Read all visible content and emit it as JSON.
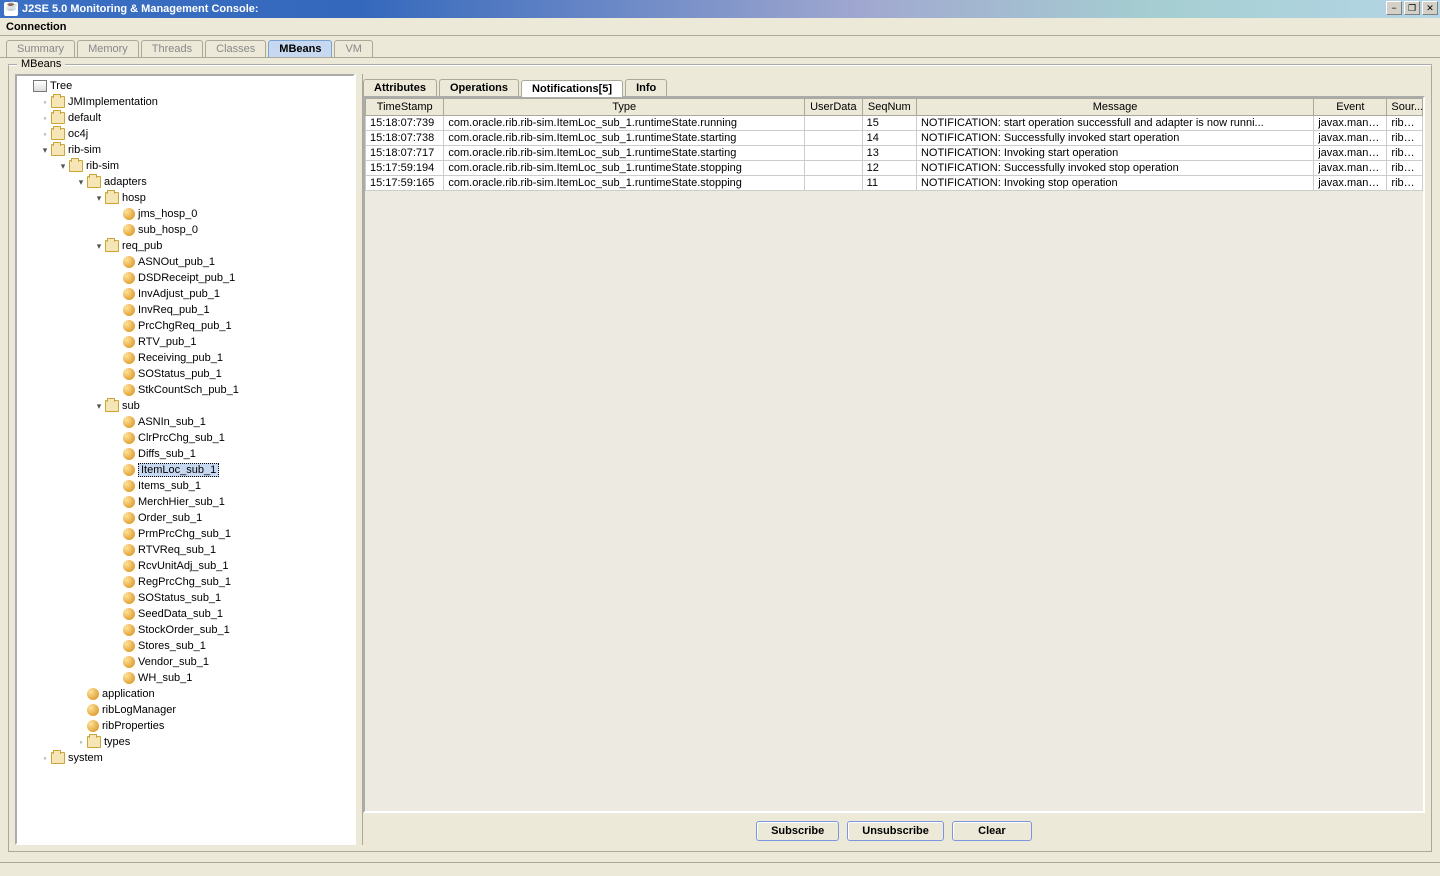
{
  "window": {
    "title": "J2SE 5.0 Monitoring & Management Console:",
    "minimize": "−",
    "maximize": "❐",
    "close": "✕"
  },
  "menu": {
    "connection": "Connection"
  },
  "topTabs": [
    {
      "label": "Summary",
      "active": false
    },
    {
      "label": "Memory",
      "active": false
    },
    {
      "label": "Threads",
      "active": false
    },
    {
      "label": "Classes",
      "active": false
    },
    {
      "label": "MBeans",
      "active": true
    },
    {
      "label": "VM",
      "active": false
    }
  ],
  "panelLabel": "MBeans",
  "tree": [
    {
      "indent": 0,
      "toggle": "",
      "icon": "root",
      "label": "Tree"
    },
    {
      "indent": 1,
      "toggle": "◦─",
      "icon": "folder",
      "label": "JMImplementation"
    },
    {
      "indent": 1,
      "toggle": "◦─",
      "icon": "folder",
      "label": "default"
    },
    {
      "indent": 1,
      "toggle": "◦─",
      "icon": "folder",
      "label": "oc4j"
    },
    {
      "indent": 1,
      "toggle": "▾",
      "icon": "folder",
      "label": "rib-sim"
    },
    {
      "indent": 2,
      "toggle": "▾",
      "icon": "folder",
      "label": "rib-sim"
    },
    {
      "indent": 3,
      "toggle": "▾",
      "icon": "folder",
      "label": "adapters"
    },
    {
      "indent": 4,
      "toggle": "▾",
      "icon": "folder",
      "label": "hosp"
    },
    {
      "indent": 5,
      "toggle": "",
      "icon": "bean",
      "label": "jms_hosp_0"
    },
    {
      "indent": 5,
      "toggle": "",
      "icon": "bean",
      "label": "sub_hosp_0"
    },
    {
      "indent": 4,
      "toggle": "▾",
      "icon": "folder",
      "label": "req_pub"
    },
    {
      "indent": 5,
      "toggle": "",
      "icon": "bean",
      "label": "ASNOut_pub_1"
    },
    {
      "indent": 5,
      "toggle": "",
      "icon": "bean",
      "label": "DSDReceipt_pub_1"
    },
    {
      "indent": 5,
      "toggle": "",
      "icon": "bean",
      "label": "InvAdjust_pub_1"
    },
    {
      "indent": 5,
      "toggle": "",
      "icon": "bean",
      "label": "InvReq_pub_1"
    },
    {
      "indent": 5,
      "toggle": "",
      "icon": "bean",
      "label": "PrcChgReq_pub_1"
    },
    {
      "indent": 5,
      "toggle": "",
      "icon": "bean",
      "label": "RTV_pub_1"
    },
    {
      "indent": 5,
      "toggle": "",
      "icon": "bean",
      "label": "Receiving_pub_1"
    },
    {
      "indent": 5,
      "toggle": "",
      "icon": "bean",
      "label": "SOStatus_pub_1"
    },
    {
      "indent": 5,
      "toggle": "",
      "icon": "bean",
      "label": "StkCountSch_pub_1"
    },
    {
      "indent": 4,
      "toggle": "▾",
      "icon": "folder",
      "label": "sub"
    },
    {
      "indent": 5,
      "toggle": "",
      "icon": "bean",
      "label": "ASNIn_sub_1"
    },
    {
      "indent": 5,
      "toggle": "",
      "icon": "bean",
      "label": "ClrPrcChg_sub_1"
    },
    {
      "indent": 5,
      "toggle": "",
      "icon": "bean",
      "label": "Diffs_sub_1"
    },
    {
      "indent": 5,
      "toggle": "",
      "icon": "bean",
      "label": "ItemLoc_sub_1",
      "selected": true
    },
    {
      "indent": 5,
      "toggle": "",
      "icon": "bean",
      "label": "Items_sub_1"
    },
    {
      "indent": 5,
      "toggle": "",
      "icon": "bean",
      "label": "MerchHier_sub_1"
    },
    {
      "indent": 5,
      "toggle": "",
      "icon": "bean",
      "label": "Order_sub_1"
    },
    {
      "indent": 5,
      "toggle": "",
      "icon": "bean",
      "label": "PrmPrcChg_sub_1"
    },
    {
      "indent": 5,
      "toggle": "",
      "icon": "bean",
      "label": "RTVReq_sub_1"
    },
    {
      "indent": 5,
      "toggle": "",
      "icon": "bean",
      "label": "RcvUnitAdj_sub_1"
    },
    {
      "indent": 5,
      "toggle": "",
      "icon": "bean",
      "label": "RegPrcChg_sub_1"
    },
    {
      "indent": 5,
      "toggle": "",
      "icon": "bean",
      "label": "SOStatus_sub_1"
    },
    {
      "indent": 5,
      "toggle": "",
      "icon": "bean",
      "label": "SeedData_sub_1"
    },
    {
      "indent": 5,
      "toggle": "",
      "icon": "bean",
      "label": "StockOrder_sub_1"
    },
    {
      "indent": 5,
      "toggle": "",
      "icon": "bean",
      "label": "Stores_sub_1"
    },
    {
      "indent": 5,
      "toggle": "",
      "icon": "bean",
      "label": "Vendor_sub_1"
    },
    {
      "indent": 5,
      "toggle": "",
      "icon": "bean",
      "label": "WH_sub_1"
    },
    {
      "indent": 3,
      "toggle": "",
      "icon": "bean",
      "label": "application"
    },
    {
      "indent": 3,
      "toggle": "",
      "icon": "bean",
      "label": "ribLogManager"
    },
    {
      "indent": 3,
      "toggle": "",
      "icon": "bean",
      "label": "ribProperties"
    },
    {
      "indent": 3,
      "toggle": "◦─",
      "icon": "folder",
      "label": "types"
    },
    {
      "indent": 1,
      "toggle": "◦─",
      "icon": "folder",
      "label": "system"
    }
  ],
  "detailTabs": [
    {
      "label": "Attributes",
      "active": false
    },
    {
      "label": "Operations",
      "active": false
    },
    {
      "label": "Notifications[5]",
      "active": true
    },
    {
      "label": "Info",
      "active": false
    }
  ],
  "tableHeaders": [
    "TimeStamp",
    "Type",
    "UserData",
    "SeqNum",
    "Message",
    "Event",
    "Sour..."
  ],
  "columnWidths": [
    "75px",
    "345px",
    "55px",
    "52px",
    "380px",
    "70px",
    "34px"
  ],
  "rows": [
    [
      "15:18:07:739",
      "com.oracle.rib.rib-sim.ItemLoc_sub_1.runtimeState.running",
      "",
      "15",
      "NOTIFICATION: start operation successfull and adapter is now runni...",
      "javax.mana...",
      "rib-s..."
    ],
    [
      "15:18:07:738",
      "com.oracle.rib.rib-sim.ItemLoc_sub_1.runtimeState.starting",
      "",
      "14",
      "NOTIFICATION: Successfully invoked start operation",
      "javax.mana...",
      "rib-s..."
    ],
    [
      "15:18:07:717",
      "com.oracle.rib.rib-sim.ItemLoc_sub_1.runtimeState.starting",
      "",
      "13",
      "NOTIFICATION: Invoking start operation",
      "javax.mana...",
      "rib-s..."
    ],
    [
      "15:17:59:194",
      "com.oracle.rib.rib-sim.ItemLoc_sub_1.runtimeState.stopping",
      "",
      "12",
      "NOTIFICATION: Successfully invoked stop operation",
      "javax.mana...",
      "rib-s..."
    ],
    [
      "15:17:59:165",
      "com.oracle.rib.rib-sim.ItemLoc_sub_1.runtimeState.stopping",
      "",
      "11",
      "NOTIFICATION: Invoking stop operation",
      "javax.mana...",
      "rib-s..."
    ]
  ],
  "buttons": {
    "subscribe": "Subscribe",
    "unsubscribe": "Unsubscribe",
    "clear": "Clear"
  }
}
